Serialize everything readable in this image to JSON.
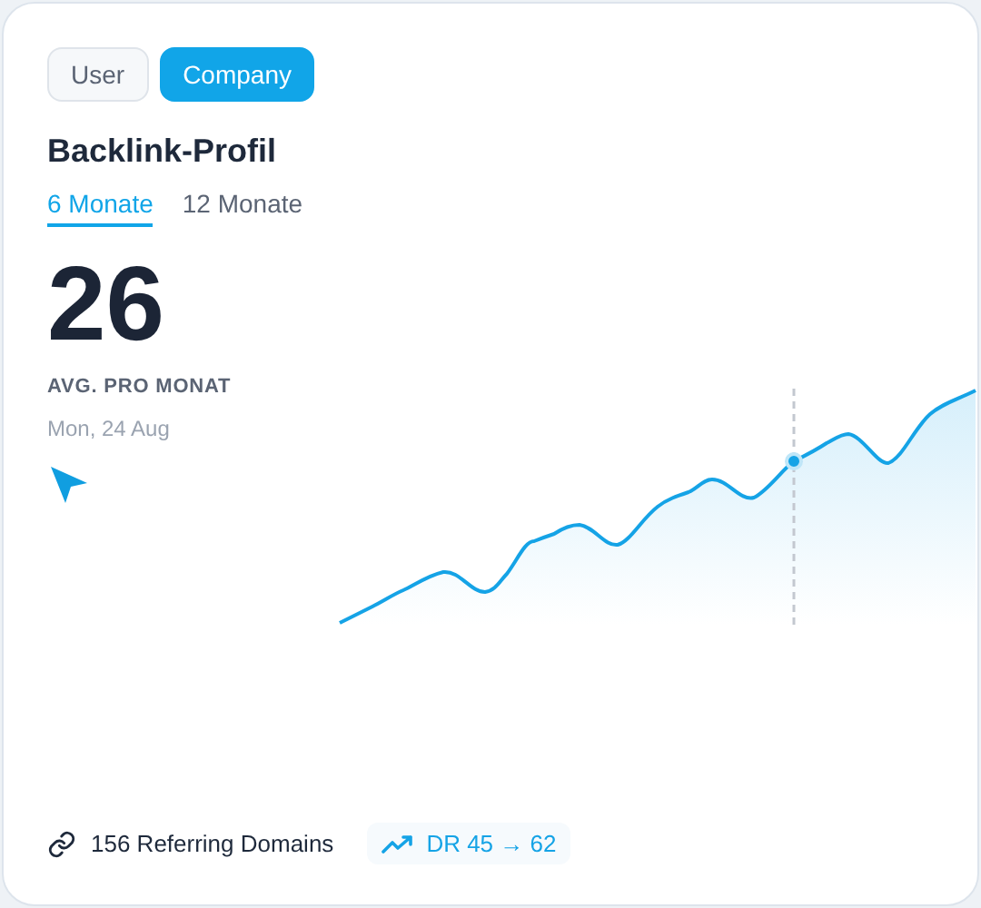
{
  "toggle": [
    {
      "label": "User",
      "selected": false
    },
    {
      "label": "Company",
      "selected": true
    }
  ],
  "title": "Backlink-Profil",
  "periods": [
    {
      "label": "6 Monate",
      "selected": true
    },
    {
      "label": "12 Monate",
      "selected": false
    }
  ],
  "value": "26",
  "value_label": "AVG. PRO MONAT",
  "hover_date": "Mon, 24 Aug",
  "footer": {
    "domains": "156 Referring Domains",
    "dr": "DR 45 → 62"
  }
}
